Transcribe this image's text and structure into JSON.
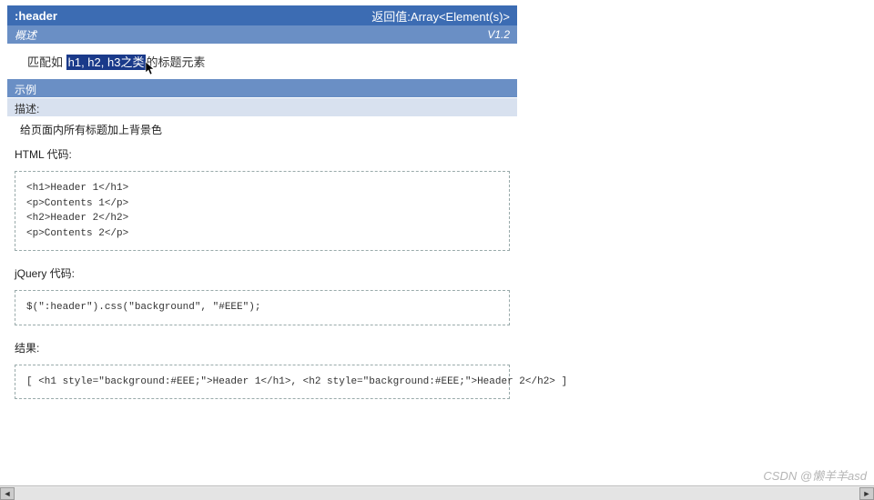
{
  "header": {
    "title": ":header",
    "return_label": "返回值:Array<Element(s)>"
  },
  "overview": {
    "label": "概述",
    "version": "V1.2"
  },
  "match": {
    "prefix": "匹配如 ",
    "highlight": "h1, h2, h3之类",
    "suffix": "的标题元素"
  },
  "example_label": "示例",
  "desc_label": "描述:",
  "desc_text": "给页面内所有标题加上背景色",
  "html_label": "HTML 代码:",
  "html_code": "<h1>Header 1</h1>\n<p>Contents 1</p>\n<h2>Header 2</h2>\n<p>Contents 2</p>",
  "jquery_label": "jQuery 代码:",
  "jquery_code": "$(\":header\").css(\"background\", \"#EEE\");",
  "result_label": "结果:",
  "result_code": "[ <h1 style=\"background:#EEE;\">Header 1</h1>, <h2 style=\"background:#EEE;\">Header 2</h2> ]",
  "watermark": "CSDN @懒羊羊asd"
}
